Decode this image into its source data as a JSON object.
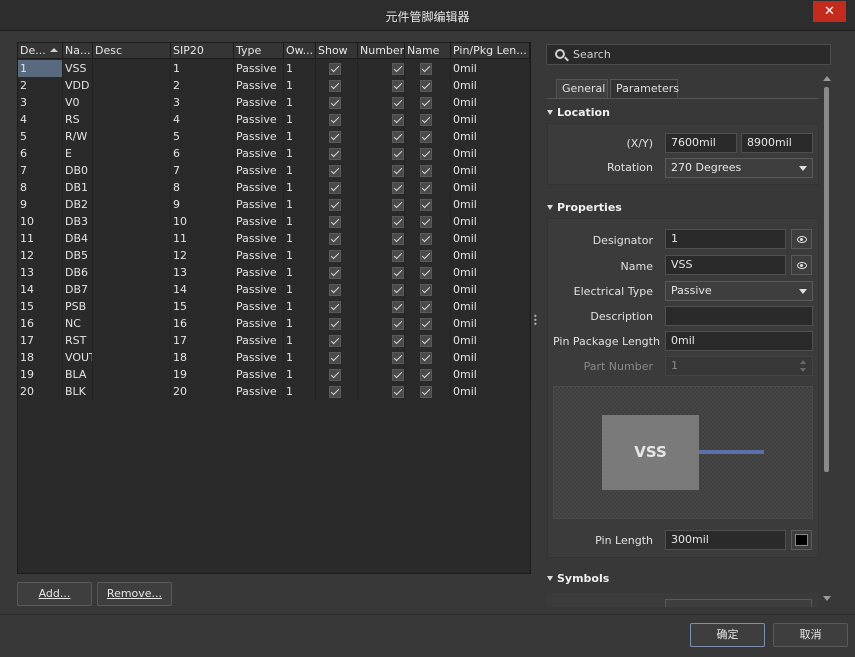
{
  "window": {
    "title": "元件管脚编辑器",
    "close_glyph": "✕"
  },
  "table": {
    "columns": [
      "De...",
      "Na...",
      "Desc",
      "SIP20",
      "Type",
      "Ow...",
      "Show",
      "Number",
      "Name",
      "Pin/Pkg Len..."
    ],
    "rows": [
      {
        "des": "1",
        "name": "VSS",
        "desc": "",
        "sip": "1",
        "type": "Passive",
        "owner": "1",
        "pkg": "0mil"
      },
      {
        "des": "2",
        "name": "VDD",
        "desc": "",
        "sip": "2",
        "type": "Passive",
        "owner": "1",
        "pkg": "0mil"
      },
      {
        "des": "3",
        "name": "V0",
        "desc": "",
        "sip": "3",
        "type": "Passive",
        "owner": "1",
        "pkg": "0mil"
      },
      {
        "des": "4",
        "name": "RS",
        "desc": "",
        "sip": "4",
        "type": "Passive",
        "owner": "1",
        "pkg": "0mil"
      },
      {
        "des": "5",
        "name": "R/W",
        "desc": "",
        "sip": "5",
        "type": "Passive",
        "owner": "1",
        "pkg": "0mil"
      },
      {
        "des": "6",
        "name": "E",
        "desc": "",
        "sip": "6",
        "type": "Passive",
        "owner": "1",
        "pkg": "0mil"
      },
      {
        "des": "7",
        "name": "DB0",
        "desc": "",
        "sip": "7",
        "type": "Passive",
        "owner": "1",
        "pkg": "0mil"
      },
      {
        "des": "8",
        "name": "DB1",
        "desc": "",
        "sip": "8",
        "type": "Passive",
        "owner": "1",
        "pkg": "0mil"
      },
      {
        "des": "9",
        "name": "DB2",
        "desc": "",
        "sip": "9",
        "type": "Passive",
        "owner": "1",
        "pkg": "0mil"
      },
      {
        "des": "10",
        "name": "DB3",
        "desc": "",
        "sip": "10",
        "type": "Passive",
        "owner": "1",
        "pkg": "0mil"
      },
      {
        "des": "11",
        "name": "DB4",
        "desc": "",
        "sip": "11",
        "type": "Passive",
        "owner": "1",
        "pkg": "0mil"
      },
      {
        "des": "12",
        "name": "DB5",
        "desc": "",
        "sip": "12",
        "type": "Passive",
        "owner": "1",
        "pkg": "0mil"
      },
      {
        "des": "13",
        "name": "DB6",
        "desc": "",
        "sip": "13",
        "type": "Passive",
        "owner": "1",
        "pkg": "0mil"
      },
      {
        "des": "14",
        "name": "DB7",
        "desc": "",
        "sip": "14",
        "type": "Passive",
        "owner": "1",
        "pkg": "0mil"
      },
      {
        "des": "15",
        "name": "PSB",
        "desc": "",
        "sip": "15",
        "type": "Passive",
        "owner": "1",
        "pkg": "0mil"
      },
      {
        "des": "16",
        "name": "NC",
        "desc": "",
        "sip": "16",
        "type": "Passive",
        "owner": "1",
        "pkg": "0mil"
      },
      {
        "des": "17",
        "name": "RST",
        "desc": "",
        "sip": "17",
        "type": "Passive",
        "owner": "1",
        "pkg": "0mil"
      },
      {
        "des": "18",
        "name": "VOUT",
        "desc": "",
        "sip": "18",
        "type": "Passive",
        "owner": "1",
        "pkg": "0mil"
      },
      {
        "des": "19",
        "name": "BLA",
        "desc": "",
        "sip": "19",
        "type": "Passive",
        "owner": "1",
        "pkg": "0mil"
      },
      {
        "des": "20",
        "name": "BLK",
        "desc": "",
        "sip": "20",
        "type": "Passive",
        "owner": "1",
        "pkg": "0mil"
      }
    ]
  },
  "buttons": {
    "add": "Add...",
    "remove": "Remove...",
    "ok": "确定",
    "cancel": "取消"
  },
  "panel": {
    "search_placeholder": "Search",
    "tabs": [
      "General",
      "Parameters"
    ],
    "location": {
      "header": "Location",
      "xy_label": "(X/Y)",
      "x": "7600mil",
      "y": "8900mil",
      "rotation_label": "Rotation",
      "rotation": "270 Degrees"
    },
    "properties": {
      "header": "Properties",
      "designator_label": "Designator",
      "designator": "1",
      "name_label": "Name",
      "name": "VSS",
      "etype_label": "Electrical Type",
      "etype": "Passive",
      "desc_label": "Description",
      "desc": "",
      "pkglen_label": "Pin Package Length",
      "pkglen": "0mil",
      "part_label": "Part Number",
      "part": "1",
      "preview_text": "VSS",
      "pinlen_label": "Pin Length",
      "pinlen": "300mil"
    },
    "symbols": {
      "header": "Symbols"
    }
  }
}
